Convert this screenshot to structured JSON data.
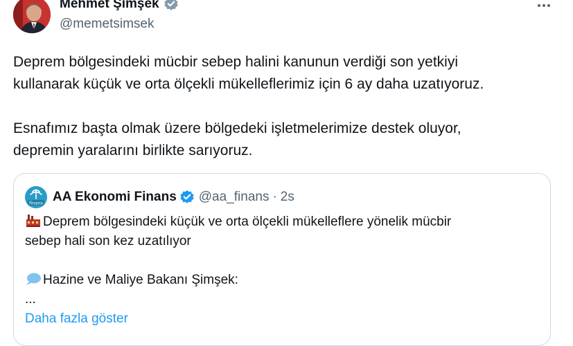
{
  "author": {
    "name": "Mehmet Şimşek",
    "handle": "@memetsimsek"
  },
  "tweet": {
    "lines": [
      "Deprem bölgesindeki mücbir sebep halini kanunun verdiği son yetkiyi",
      "kullanarak küçük ve orta ölçekli mükelleflerimiz için 6 ay daha uzatıyoruz.",
      "Esnafımız başta olmak üzere bölgedeki işletmelerimize destek oluyor,",
      "depremin yaralarını birlikte sarıyoruz."
    ]
  },
  "quote": {
    "name": "AA Ekonomi Finans",
    "handle": "@aa_finans",
    "separator": "·",
    "time": "2s",
    "logo_text": "finans",
    "line1": "Deprem bölgesindeki küçük ve orta ölçekli mükelleflere yönelik mücbir",
    "line2": "sebep hali son kez uzatılıyor",
    "line3": "Hazine ve Maliye Bakanı Şimşek:",
    "line4": "...",
    "show_more": "Daha fazla göster"
  },
  "icons": {
    "verified": "verified-badge-icon",
    "more": "more-options-icon",
    "factory": "factory-emoji-icon",
    "speech": "speech-bubble-emoji-icon"
  },
  "colors": {
    "link": "#1d9bf0",
    "secondary_text": "#536471",
    "border": "#cfd9de",
    "badge_gray": "#829aab",
    "badge_blue": "#1d9bf0"
  }
}
